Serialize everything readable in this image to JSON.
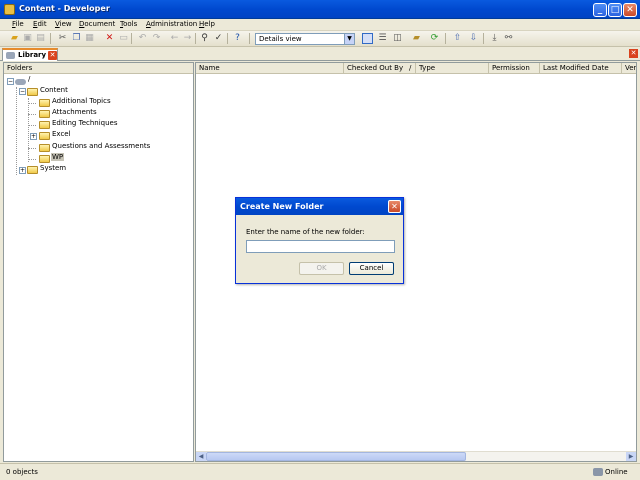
{
  "window": {
    "title": "Content - Developer"
  },
  "menu": [
    "File",
    "Edit",
    "View",
    "Document",
    "Tools",
    "Administration",
    "Help"
  ],
  "toolbar": {
    "view_select": "Details view"
  },
  "tabs": {
    "library_label": "Library"
  },
  "folders": {
    "header": "Folders",
    "root": "/",
    "items": {
      "content": "Content",
      "additional_topics": "Additional Topics",
      "attachments": "Attachments",
      "editing_techniques": "Editing Techniques",
      "excel": "Excel",
      "questions": "Questions and Assessments",
      "wp": "WP",
      "system": "System"
    }
  },
  "list": {
    "columns": [
      "Name",
      "Checked Out By",
      "/",
      "Type",
      "Permission",
      "Last Modified Date",
      "Ver"
    ]
  },
  "dialog": {
    "title": "Create New Folder",
    "prompt": "Enter the name of the new folder:",
    "input_value": "",
    "ok_label": "OK",
    "cancel_label": "Cancel"
  },
  "status": {
    "objects": "0 objects",
    "connection": "Online"
  },
  "colors": {
    "titlebar": "#0050d8",
    "face": "#ece9d8",
    "selection": "#c6c3b6",
    "tab_accent": "#e68b2c"
  }
}
